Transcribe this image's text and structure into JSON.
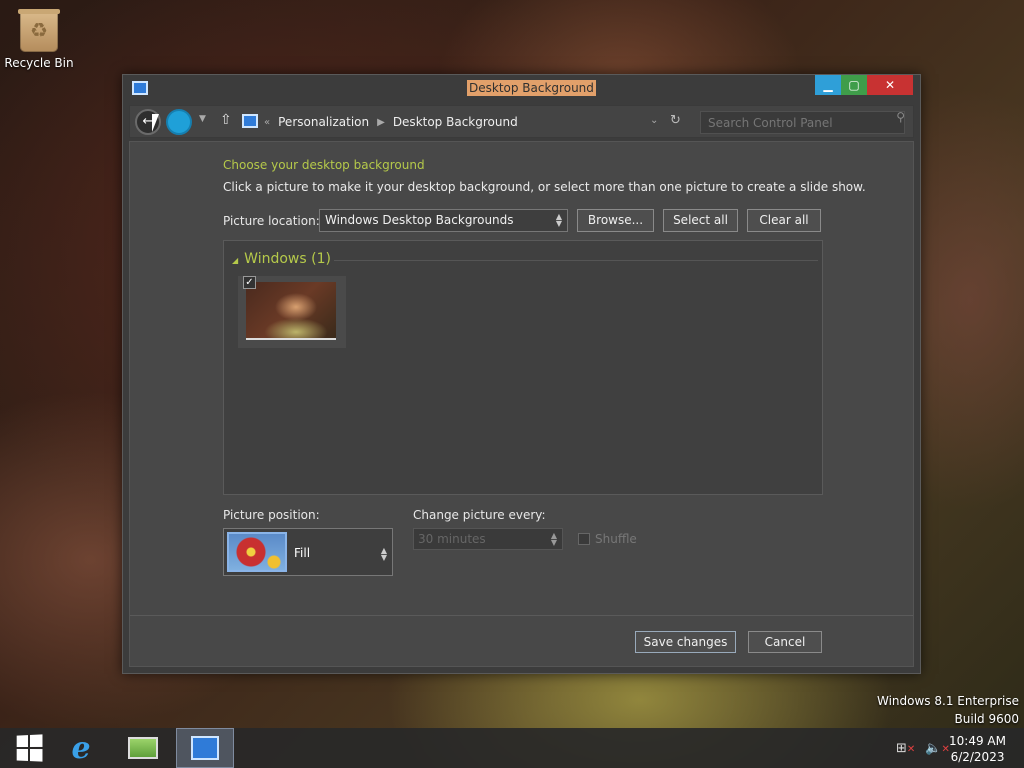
{
  "desktop": {
    "recycle_bin_label": "Recycle Bin",
    "watermark_line1": "Windows 8.1 Enterprise",
    "watermark_line2": "Build 9600"
  },
  "window": {
    "title": "Desktop Background",
    "breadcrumb": [
      "Personalization",
      "Desktop Background"
    ],
    "breadcrumb_prefix": "«",
    "search_placeholder": "Search Control Panel"
  },
  "content": {
    "heading": "Choose your desktop background",
    "description": "Click a picture to make it your desktop background, or select more than one picture to create a slide show.",
    "picture_location_label": "Picture location:",
    "picture_location_value": "Windows Desktop Backgrounds",
    "browse_label": "Browse...",
    "select_all_label": "Select all",
    "clear_all_label": "Clear all",
    "group_label": "Windows (1)",
    "picture_position_label": "Picture position:",
    "picture_position_value": "Fill",
    "change_picture_label": "Change picture every:",
    "change_picture_value": "30 minutes",
    "shuffle_label": "Shuffle",
    "save_label": "Save changes",
    "cancel_label": "Cancel"
  },
  "taskbar": {
    "time": "10:49 AM",
    "date": "6/2/2023"
  },
  "colors": {
    "accent": "#b5c94a",
    "title_highlight": "#e2a06a"
  }
}
